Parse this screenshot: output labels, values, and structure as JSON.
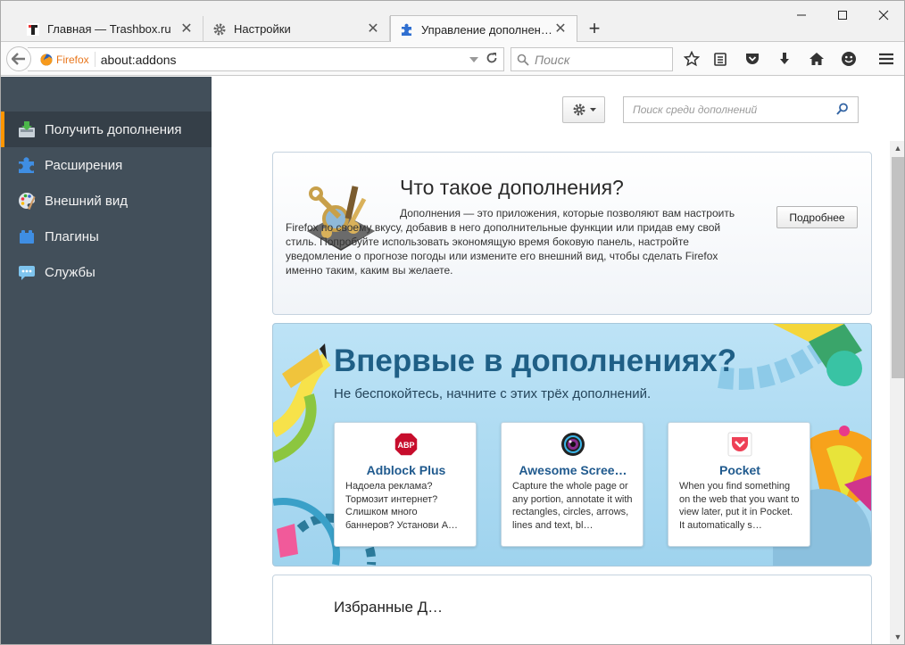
{
  "tabs": [
    {
      "label": "Главная — Trashbox.ru",
      "icon": "trashbox-favicon"
    },
    {
      "label": "Настройки",
      "icon": "gear-icon"
    },
    {
      "label": "Управление дополнениями",
      "icon": "puzzle-icon"
    }
  ],
  "navbar": {
    "identity": "Firefox",
    "url": "about:addons",
    "search_placeholder": "Поиск"
  },
  "sidebar": {
    "items": [
      {
        "label": "Получить дополнения",
        "icon": "get-addons-icon",
        "selected": true
      },
      {
        "label": "Расширения",
        "icon": "puzzle-icon",
        "selected": false
      },
      {
        "label": "Внешний вид",
        "icon": "palette-icon",
        "selected": false
      },
      {
        "label": "Плагины",
        "icon": "plugin-brick-icon",
        "selected": false
      },
      {
        "label": "Службы",
        "icon": "services-bubble-icon",
        "selected": false
      }
    ]
  },
  "content": {
    "search_placeholder": "Поиск среди дополнений",
    "intro": {
      "title": "Что такое дополнения?",
      "text": "Дополнения — это приложения, которые позволяют вам настроить Firefox по своему вкусу, добавив в него дополнительные функции или придав ему свой стиль. Попробуйте использовать экономящую время боковую панель, настройте уведомление о прогнозе погоды или измените его внешний вид, чтобы сделать Firefox именно таким, каким вы желаете.",
      "more_button": "Подробнее"
    },
    "promo": {
      "title": "Впервые в дополнениях?",
      "subtitle": "Не беспокойтесь, начните с этих трёх дополнений.",
      "addons": [
        {
          "name": "Adblock Plus",
          "desc": "Надоела реклама? Тормозит интернет? Слишком много баннеров? Установи А…",
          "icon": "abp-icon"
        },
        {
          "name": "Awesome Scree…",
          "desc": "Capture the whole page or any portion, annotate it with rectangles, circles, arrows, lines and text, bl…",
          "icon": "camera-lens-icon"
        },
        {
          "name": "Pocket",
          "desc": "When you find something on the web that you want to view later, put it in Pocket. It automatically s…",
          "icon": "pocket-icon"
        }
      ]
    },
    "next_section_title": "Избранные Д…"
  },
  "colors": {
    "sidebar_bg": "#424f5a",
    "sidebar_selected_accent": "#ff9500",
    "promo_title": "#1f5f86",
    "addon_name": "#205a8e"
  }
}
